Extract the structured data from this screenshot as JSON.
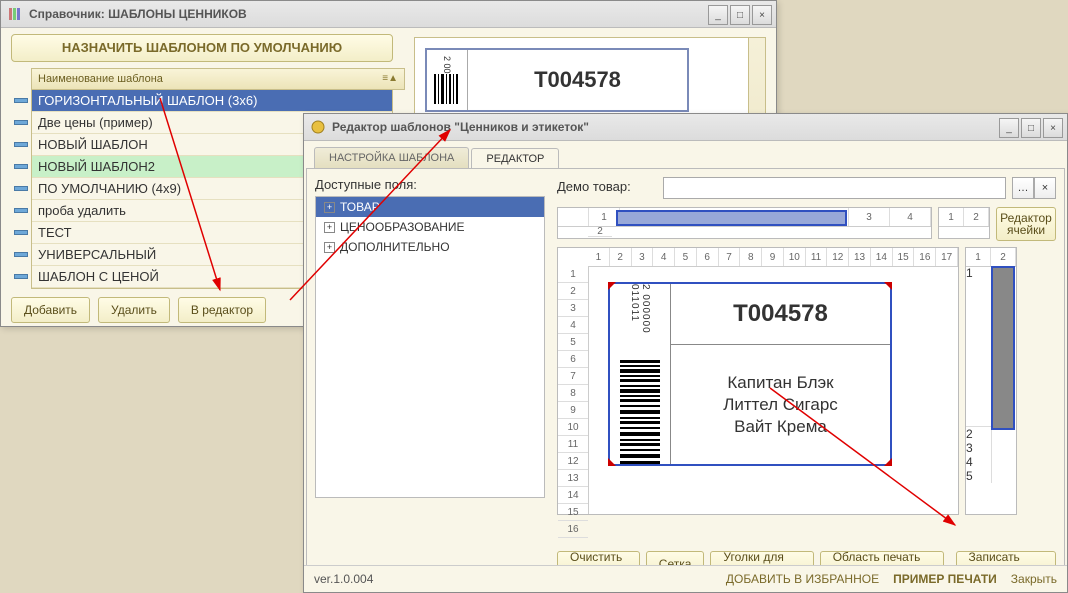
{
  "window1": {
    "title": "Справочник: ШАБЛОНЫ ЦЕННИКОВ",
    "default_btn": "НАЗНАЧИТЬ ШАБЛОНОМ ПО УМОЛЧАНИЮ",
    "column_header": "Наименование шаблона",
    "templates": [
      {
        "name": "ГОРИЗОНТАЛЬНЫЙ ШАБЛОН (3x6)",
        "selected": true
      },
      {
        "name": "Две цены (пример)"
      },
      {
        "name": "НОВЫЙ ШАБЛОН"
      },
      {
        "name": "НОВЫЙ ШАБЛОН2",
        "green": true
      },
      {
        "name": "ПО УМОЛЧАНИЮ (4x9)"
      },
      {
        "name": "проба удалить"
      },
      {
        "name": "ТЕСТ"
      },
      {
        "name": "УНИВЕРСАЛЬНЫЙ"
      },
      {
        "name": "ШАБЛОН С ЦЕНОЙ"
      }
    ],
    "buttons": {
      "add": "Добавить",
      "del": "Удалить",
      "edit": "В редактор"
    },
    "preview": {
      "code": "T004578",
      "barcode_digits": "2 00"
    }
  },
  "window2": {
    "title": "Редактор шаблонов \"Ценников и этикеток\"",
    "tabs": {
      "settings": "НАСТРОЙКА ШАБЛОНА",
      "editor": "РЕДАКТОР"
    },
    "available_fields_label": "Доступные поля:",
    "demo_label": "Демо товар:",
    "tree": [
      {
        "label": "ТОВАР",
        "selected": true
      },
      {
        "label": "ЦЕНООБРАЗОВАНИЕ"
      },
      {
        "label": "ДОПОЛНИТЕЛЬНО"
      }
    ],
    "cell_editor": "Редактор ячейки",
    "top_ruler": [
      "1",
      "2",
      "3",
      "4"
    ],
    "top_ruler2": [
      "1",
      "2",
      "3",
      "4",
      "5",
      "6",
      "7",
      "8",
      "9",
      "10",
      "11",
      "12",
      "13",
      "14",
      "15",
      "16",
      "17"
    ],
    "left_ruler": [
      "1",
      "2",
      "3",
      "4",
      "5",
      "6",
      "7",
      "8",
      "9",
      "10",
      "11",
      "12",
      "13",
      "14",
      "15",
      "16"
    ],
    "side_ruler": [
      "1",
      "2",
      "1",
      "2",
      "3",
      "4",
      "5"
    ],
    "tag": {
      "code": "T004578",
      "desc1": "Капитан Блэк",
      "desc2": "Литтел Сигарс",
      "desc3": "Вайт Крема",
      "barcode_text": "2 000000 011011"
    },
    "bottom_buttons": {
      "clear": "Очистить все",
      "grid": "Сетка",
      "corners": "Уголки для печати",
      "area": "Область печать задать",
      "save": "Записать шаблон"
    },
    "status": {
      "version": "ver.1.0.004",
      "fav": "ДОБАВИТЬ В ИЗБРАННОЕ",
      "print": "ПРИМЕР ПЕЧАТИ",
      "close": "Закрыть"
    }
  }
}
